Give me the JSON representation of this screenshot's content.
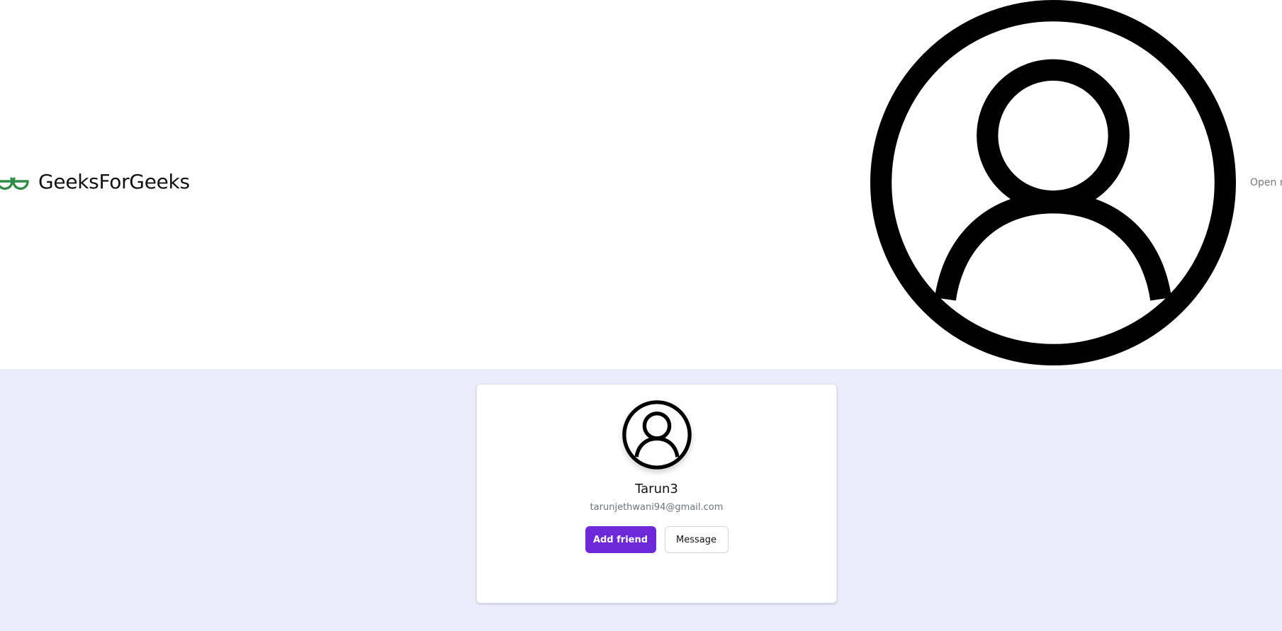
{
  "header": {
    "brand_name": "GeeksForGeeks",
    "logo_icon": "gfg-logo-icon",
    "user_menu": {
      "screenreader_label": "Open main menu",
      "icon": "user-circle-icon"
    }
  },
  "profile": {
    "avatar_icon": "user-circle-icon",
    "name": "Tarun3",
    "email": "tarunjethwani94@gmail.com",
    "add_friend_label": "Add friend",
    "message_label": "Message"
  },
  "colors": {
    "logo_green": "#2f8d46",
    "page_background": "#ececfd",
    "primary_button": "#6d28d9"
  }
}
